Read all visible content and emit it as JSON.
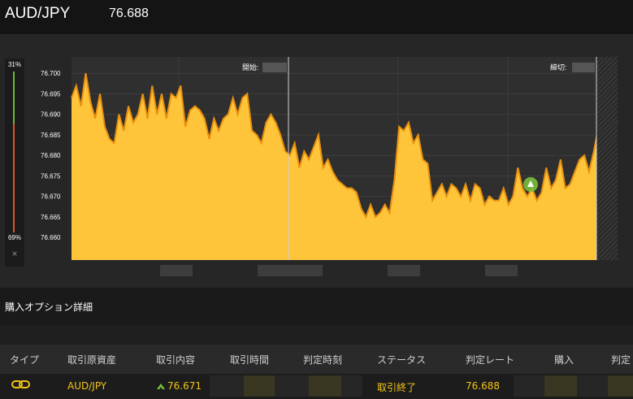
{
  "header": {
    "pair": "AUD/JPY",
    "rate": "76.688"
  },
  "meter": {
    "top_pct": "31%",
    "bottom_pct": "69%",
    "close_label": "×",
    "up_fraction": 0.31,
    "down_fraction": 0.69,
    "colors": {
      "up": "#6dbb2a",
      "down": "#d9582a"
    }
  },
  "chart": {
    "start_label": "開始:",
    "end_label": "締切:",
    "y_ticks": [
      "76.700",
      "76.695",
      "76.690",
      "76.685",
      "76.680",
      "76.675",
      "76.670",
      "76.665",
      "76.660"
    ],
    "area_color": "#ffc53a",
    "line_color": "#e8900f",
    "entry_marker_color": "#7bbf3c"
  },
  "chart_data": {
    "type": "area",
    "title": "",
    "xlabel": "",
    "ylabel": "",
    "ylim": [
      76.6545,
      76.704
    ],
    "y": [
      76.694,
      76.697,
      76.692,
      76.7,
      76.693,
      76.689,
      76.695,
      76.687,
      76.684,
      76.683,
      76.69,
      76.686,
      76.692,
      76.688,
      76.69,
      76.695,
      76.689,
      76.697,
      76.69,
      76.695,
      76.689,
      76.695,
      76.694,
      76.697,
      76.687,
      76.691,
      76.692,
      76.691,
      76.689,
      76.684,
      76.689,
      76.686,
      76.689,
      76.69,
      76.694,
      76.69,
      76.694,
      76.695,
      76.686,
      76.685,
      76.683,
      76.688,
      76.69,
      76.688,
      76.685,
      76.681,
      76.68,
      76.683,
      76.677,
      76.681,
      76.679,
      76.682,
      76.685,
      76.677,
      76.679,
      76.676,
      76.674,
      76.673,
      76.672,
      76.672,
      76.671,
      76.667,
      76.665,
      76.668,
      76.665,
      76.666,
      76.668,
      76.666,
      76.674,
      76.687,
      76.686,
      76.688,
      76.683,
      76.685,
      76.679,
      76.678,
      76.669,
      76.671,
      76.673,
      76.67,
      76.673,
      76.672,
      76.67,
      76.673,
      76.669,
      76.673,
      76.672,
      76.668,
      76.67,
      76.669,
      76.669,
      76.672,
      76.668,
      76.67,
      76.677,
      76.672,
      76.67,
      76.672,
      76.669,
      76.671,
      76.677,
      76.672,
      76.674,
      76.679,
      76.672,
      76.673,
      76.676,
      76.679,
      76.68,
      76.676,
      76.681,
      76.687,
      76.687,
      76.688,
      76.687,
      76.688
    ]
  },
  "time_labels": [
    "",
    "",
    "",
    ""
  ],
  "section": {
    "title": "購入オプション詳細"
  },
  "table": {
    "headers": [
      "タイプ",
      "取引原資産",
      "取引内容",
      "取引時間",
      "判定時刻",
      "ステータス",
      "判定レート",
      "購入",
      "判定"
    ],
    "row": {
      "type_icon": "link-icon",
      "asset": "AUD/JPY",
      "direction_icon": "up-arrow-icon",
      "content": "76.671",
      "status": "取引終了",
      "judge_rate": "76.688"
    }
  }
}
